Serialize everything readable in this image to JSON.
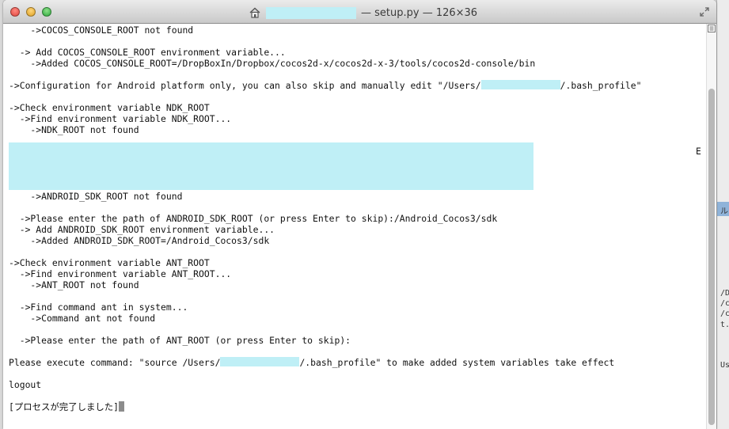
{
  "window": {
    "title": "— setup.py — 126×36"
  },
  "terminal": {
    "lines": [
      "    ->COCOS_CONSOLE_ROOT not found",
      "",
      "  -> Add COCOS_CONSOLE_ROOT environment variable...",
      "    ->Added COCOS_CONSOLE_ROOT=/DropBoxIn/Dropbox/cocos2d-x/cocos2d-x-3/tools/cocos2d-console/bin",
      "",
      "->Configuration for Android platform only, you can also skip and manually edit \"/Users/",
      "",
      "->Check environment variable NDK_ROOT",
      "  ->Find environment variable NDK_ROOT...",
      "    ->NDK_ROOT not found",
      "",
      "",
      "",
      "",
      "",
      "    ->ANDROID_SDK_ROOT not found",
      "",
      "  ->Please enter the path of ANDROID_SDK_ROOT (or press Enter to skip):/Android_Cocos3/sdk",
      "  -> Add ANDROID_SDK_ROOT environment variable...",
      "    ->Added ANDROID_SDK_ROOT=/Android_Cocos3/sdk",
      "",
      "->Check environment variable ANT_ROOT",
      "  ->Find environment variable ANT_ROOT...",
      "    ->ANT_ROOT not found",
      "",
      "  ->Find command ant in system...",
      "    ->Command ant not found",
      "",
      "  ->Please enter the path of ANT_ROOT (or press Enter to skip):",
      "",
      "Please execute command: \"source /Users/",
      "",
      "logout",
      "",
      "[プロセスが完了しました]"
    ],
    "config_line_suffix": "/.bash_profile\"",
    "execute_line_suffix": "/.bash_profile\" to make added system variables take effect",
    "stray_char": "E"
  },
  "background_window": {
    "fragments": [
      "ル",
      "/D",
      "/c",
      "/c",
      "/D",
      "t.",
      "Us"
    ]
  },
  "colors": {
    "redaction": "#bfeff6",
    "cursor": "#8c8c8c"
  },
  "icons": {
    "title": "home-icon",
    "resize": "fullscreen-arrows-icon",
    "scroll": "scroll-indicator-icon"
  }
}
